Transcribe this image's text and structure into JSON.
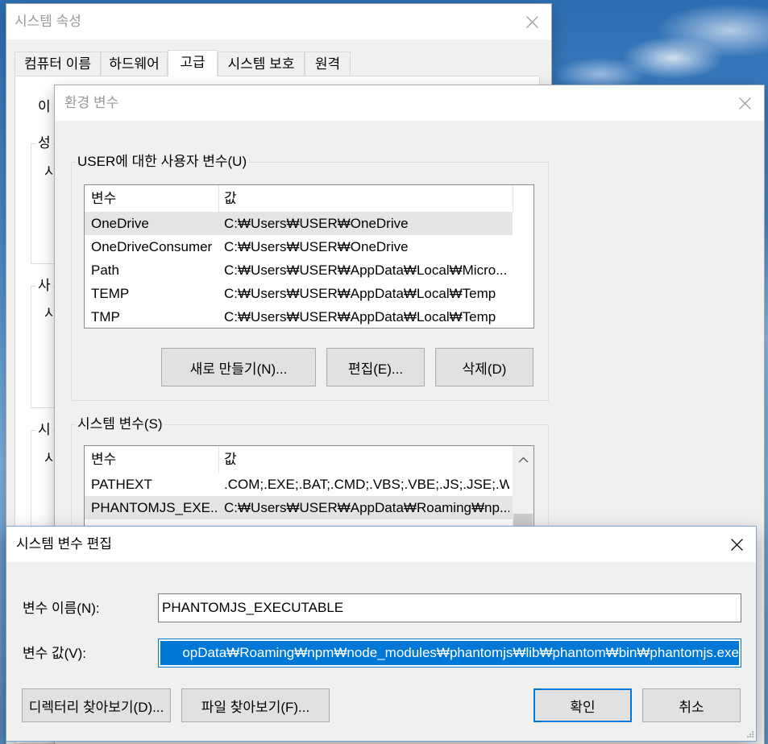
{
  "colors": {
    "accent": "#0078d7",
    "selection_inactive": "#e5e5e5",
    "dialog_face": "#f0f0f0",
    "button_face": "#e1e1e1"
  },
  "icons": {
    "close": "close-icon",
    "scroll_up": "chevron-up-icon",
    "resize": "resize-grip-icon"
  },
  "system_properties": {
    "title": "시스템 속성",
    "tabs": [
      {
        "label": "컴퓨터 이름"
      },
      {
        "label": "하드웨어"
      },
      {
        "label": "고급"
      },
      {
        "label": "시스템 보호"
      },
      {
        "label": "원격"
      }
    ],
    "selected_tab_index": 2,
    "panel": {
      "intro_fragment": "이",
      "groups": [
        {
          "label_fragment": "성",
          "text_fragment": "시"
        },
        {
          "label_fragment": "사",
          "text_fragment": "시"
        },
        {
          "label_fragment": "시",
          "text_fragment": "시"
        }
      ]
    }
  },
  "environment_variables": {
    "title": "환경 변수",
    "user_vars": {
      "label": "USER에 대한 사용자 변수(U)",
      "columns": {
        "name": "변수",
        "value": "값"
      },
      "rows": [
        {
          "name": "OneDrive",
          "value": "C:₩Users₩USER₩OneDrive"
        },
        {
          "name": "OneDriveConsumer",
          "value": "C:₩Users₩USER₩OneDrive"
        },
        {
          "name": "Path",
          "value": "C:₩Users₩USER₩AppData₩Local₩Micro..."
        },
        {
          "name": "TEMP",
          "value": "C:₩Users₩USER₩AppData₩Local₩Temp"
        },
        {
          "name": "TMP",
          "value": "C:₩Users₩USER₩AppData₩Local₩Temp"
        }
      ],
      "selected_index": 0,
      "buttons": {
        "new": "새로 만들기(N)...",
        "edit": "편집(E)...",
        "delete": "삭제(D)"
      }
    },
    "system_vars": {
      "label": "시스템 변수(S)",
      "columns": {
        "name": "변수",
        "value": "값"
      },
      "rows": [
        {
          "name": "PATHEXT",
          "value": ".COM;.EXE;.BAT;.CMD;.VBS;.VBE;.JS;.JSE;.W..."
        },
        {
          "name": "PHANTOMJS_EXE...",
          "value": "C:₩Users₩USER₩AppData₩Roaming₩np..."
        }
      ],
      "selected_index": 1
    }
  },
  "edit_dialog": {
    "title": "시스템 변수 편집",
    "name_label": "변수 이름(N):",
    "name_value": "PHANTOMJS_EXECUTABLE",
    "value_label": "변수 값(V):",
    "value_value": "opData₩Roaming₩npm₩node_modules₩phantomjs₩lib₩phantom₩bin₩phantomjs.exe",
    "buttons": {
      "browse_directory": "디렉터리 찾아보기(D)...",
      "browse_file": "파일 찾아보기(F)...",
      "ok": "확인",
      "cancel": "취소"
    }
  }
}
